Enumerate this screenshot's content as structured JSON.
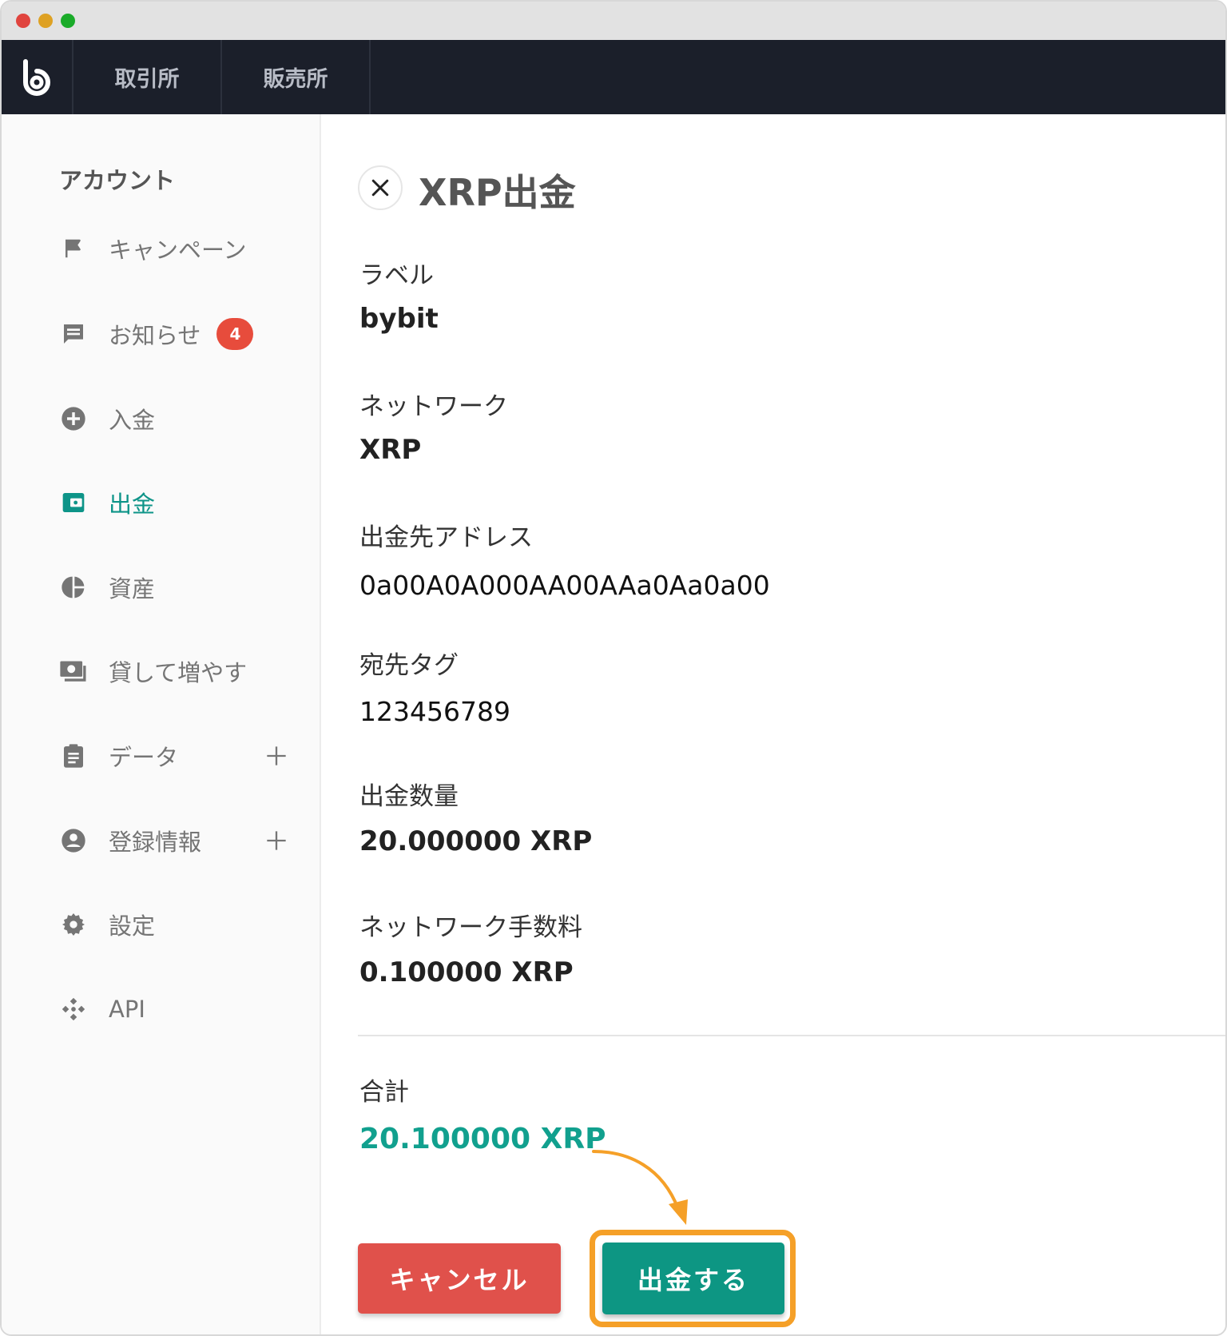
{
  "topnav": {
    "tabs": [
      {
        "label": "取引所"
      },
      {
        "label": "販売所"
      }
    ]
  },
  "sidebar": {
    "heading": "アカウント",
    "items": [
      {
        "label": "キャンペーン",
        "icon": "flag-icon"
      },
      {
        "label": "お知らせ",
        "icon": "message-icon",
        "badge": "4"
      },
      {
        "label": "入金",
        "icon": "plus-circle-icon"
      },
      {
        "label": "出金",
        "icon": "wallet-icon",
        "active": true
      },
      {
        "label": "資産",
        "icon": "pie-chart-icon"
      },
      {
        "label": "貸して増やす",
        "icon": "money-icon"
      },
      {
        "label": "データ",
        "icon": "clipboard-icon",
        "expandable": true
      },
      {
        "label": "登録情報",
        "icon": "account-icon",
        "expandable": true
      },
      {
        "label": "設定",
        "icon": "gear-icon"
      },
      {
        "label": "API",
        "icon": "api-icon"
      }
    ]
  },
  "main": {
    "title": "XRP出金",
    "fields": {
      "label": {
        "label": "ラベル",
        "value": "bybit"
      },
      "network": {
        "label": "ネットワーク",
        "value": "XRP"
      },
      "address": {
        "label": "出金先アドレス",
        "value": "0a00A0A000AA00AAa0Aa0a00"
      },
      "tag": {
        "label": "宛先タグ",
        "value": "123456789"
      },
      "amount": {
        "label": "出金数量",
        "value": "20.000000 XRP"
      },
      "fee": {
        "label": "ネットワーク手数料",
        "value": "0.100000 XRP"
      }
    },
    "total": {
      "label": "合計",
      "value": "20.100000 XRP"
    },
    "buttons": {
      "cancel": "キャンセル",
      "submit": "出金する"
    }
  },
  "colors": {
    "accent": "#0d9683",
    "cancel": "#e0514b",
    "highlight": "#f5a028",
    "navbar": "#1b1f2a"
  }
}
